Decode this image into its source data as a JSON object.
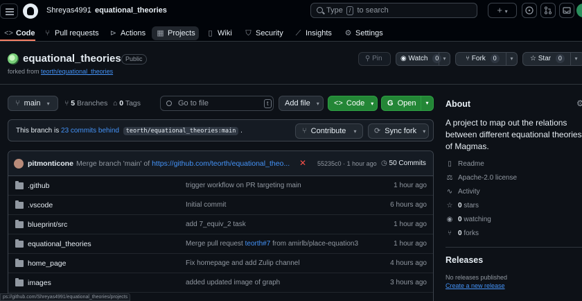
{
  "header": {
    "owner": "Shreyas4991",
    "separator": "/",
    "repo": "equational_theories",
    "search_prefix": "Type",
    "search_key": "/",
    "search_suffix": "to search",
    "plus": "+"
  },
  "nav": [
    {
      "label": "Code",
      "icon": "code-icon"
    },
    {
      "label": "Pull requests",
      "icon": "pull-request-icon"
    },
    {
      "label": "Actions",
      "icon": "play-icon"
    },
    {
      "label": "Projects",
      "icon": "table-icon"
    },
    {
      "label": "Wiki",
      "icon": "book-icon"
    },
    {
      "label": "Security",
      "icon": "shield-icon"
    },
    {
      "label": "Insights",
      "icon": "graph-icon"
    },
    {
      "label": "Settings",
      "icon": "gear-icon"
    }
  ],
  "repo": {
    "title": "equational_theories",
    "visibility": "Public",
    "forked_from_prefix": "forked from",
    "forked_from": "teorth/equational_theories",
    "pin": "Pin",
    "watch": "Watch",
    "watch_count": "0",
    "fork": "Fork",
    "fork_count": "0",
    "star": "Star",
    "star_count": "0"
  },
  "toolbar": {
    "branch": "main",
    "branches_count": "5",
    "branches_label": "Branches",
    "tags_count": "0",
    "tags_label": "Tags",
    "goto_placeholder": "Go to file",
    "goto_key": "t",
    "add_file": "Add file",
    "code": "Code",
    "open": "Open"
  },
  "behind": {
    "prefix": "This branch is",
    "link": "23 commits behind",
    "branch": "teorth/equational_theories:main",
    "suffix": ".",
    "contribute": "Contribute",
    "sync": "Sync fork"
  },
  "commit": {
    "author": "pitmonticone",
    "message": "Merge branch 'main' of",
    "link": "https://github.com/teorth/equational_theo...",
    "hash": "55235c0",
    "dot": "·",
    "time": "1 hour ago",
    "count": "50 Commits"
  },
  "files": [
    {
      "name": ".github",
      "message": "trigger workflow on PR targeting main",
      "time": "1 hour ago"
    },
    {
      "name": ".vscode",
      "message": "Initial commit",
      "time": "6 hours ago"
    },
    {
      "name": "blueprint/src",
      "message": "add 7_equiv_2 task",
      "time": "1 hour ago"
    },
    {
      "name": "equational_theories",
      "message_prefix": "Merge pull request",
      "message_link": "teorth#7",
      "message_suffix": "from amirlb/place-equation3",
      "time": "1 hour ago"
    },
    {
      "name": "home_page",
      "message": "Fix homepage and add Zulip channel",
      "time": "4 hours ago"
    },
    {
      "name": "images",
      "message": "added updated image of graph",
      "time": "3 hours ago"
    }
  ],
  "about": {
    "heading": "About",
    "description": "A project to map out the relations between different equational theories of Magmas.",
    "readme": "Readme",
    "license": "Apache-2.0 license",
    "activity": "Activity",
    "stars_count": "0",
    "stars_label": "stars",
    "watching_count": "0",
    "watching_label": "watching",
    "forks_count": "0",
    "forks_label": "forks"
  },
  "releases": {
    "heading": "Releases",
    "none": "No releases published",
    "create": "Create a new release"
  },
  "status_url": "ps://github.com/Shreyas4991/equational_theories/projects"
}
